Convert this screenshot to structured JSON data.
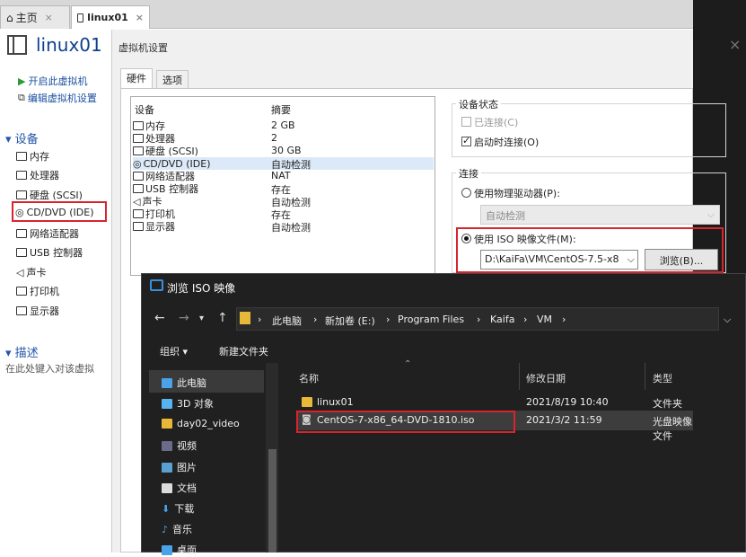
{
  "tabs": {
    "home_label": "主页",
    "vm_label": "linux01",
    "close": "×"
  },
  "left": {
    "vm_name": "linux01",
    "power_on": "开启此虚拟机",
    "edit_settings": "编辑虚拟机设置",
    "devices_title": "设备",
    "devices": [
      "内存",
      "处理器",
      "硬盘 (SCSI)",
      "CD/DVD (IDE)",
      "网络适配器",
      "USB 控制器",
      "声卡",
      "打印机",
      "显示器"
    ],
    "desc_title": "描述",
    "desc_placeholder": "在此处键入对该虚拟"
  },
  "dialog": {
    "title": "虚拟机设置",
    "close": "×",
    "tab_hardware": "硬件",
    "tab_options": "选项",
    "col_device": "设备",
    "col_summary": "摘要",
    "rows": [
      {
        "name": "内存",
        "summary": "2 GB"
      },
      {
        "name": "处理器",
        "summary": "2"
      },
      {
        "name": "硬盘 (SCSI)",
        "summary": "30 GB"
      },
      {
        "name": "CD/DVD (IDE)",
        "summary": "自动检测"
      },
      {
        "name": "网络适配器",
        "summary": "NAT"
      },
      {
        "name": "USB 控制器",
        "summary": "存在"
      },
      {
        "name": "声卡",
        "summary": "自动检测"
      },
      {
        "name": "打印机",
        "summary": "存在"
      },
      {
        "name": "显示器",
        "summary": "自动检测"
      }
    ],
    "device_status": "设备状态",
    "connected": "已连接(C)",
    "connect_on_power": "启动时连接(O)",
    "connection": "连接",
    "use_physical": "使用物理驱动器(P):",
    "physical_value": "自动检测",
    "use_iso": "使用 ISO 映像文件(M):",
    "iso_value": "D:\\KaiFa\\VM\\CentOS-7.5-x8",
    "browse": "浏览(B)..."
  },
  "browser": {
    "title": "浏览 ISO 映像",
    "breadcrumbs": [
      "此电脑",
      "新加卷 (E:)",
      "Program Files",
      "Kaifa",
      "VM"
    ],
    "organize": "组织 ▾",
    "new_folder": "新建文件夹",
    "tree": [
      "此电脑",
      "3D 对象",
      "day02_video",
      "视频",
      "图片",
      "文档",
      "下载",
      "音乐",
      "桌面"
    ],
    "col_name": "名称",
    "col_date": "修改日期",
    "col_type": "类型",
    "files": [
      {
        "name": "linux01",
        "date": "2021/8/19 10:40",
        "type": "文件夹"
      },
      {
        "name": "CentOS-7-x86_64-DVD-1810.iso",
        "date": "2021/3/2 11:59",
        "type": "光盘映像文件"
      }
    ]
  }
}
